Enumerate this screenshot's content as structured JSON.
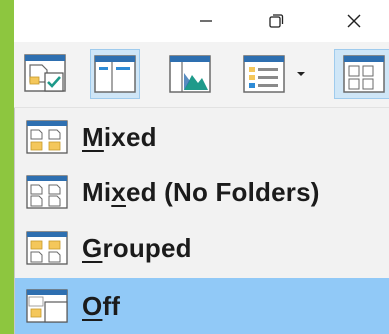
{
  "window": {
    "controls": [
      {
        "name": "minimize",
        "icon": "minimize-icon"
      },
      {
        "name": "restore",
        "icon": "restore-icon"
      },
      {
        "name": "close",
        "icon": "close-icon"
      }
    ]
  },
  "toolbar": {
    "buttons": [
      {
        "name": "check-boxes-button",
        "icon": "document-check-icon"
      },
      {
        "name": "navigation-pane-button",
        "icon": "panes-icon",
        "active": true
      },
      {
        "name": "preview-pane-button",
        "icon": "image-preview-icon"
      },
      {
        "name": "details-view-button",
        "icon": "list-details-icon",
        "has_dropdown": true
      },
      {
        "name": "layout-button",
        "icon": "grid-files-icon",
        "active": true
      }
    ]
  },
  "menu": {
    "items": [
      {
        "accel": "M",
        "rest": "ixed",
        "icon": "mixed-icon",
        "selected": false
      },
      {
        "accel": "",
        "pre": "Mi",
        "accel2": "x",
        "rest": "ed (No Folders)",
        "icon": "mixed-no-folders-icon",
        "selected": false
      },
      {
        "accel": "G",
        "rest": "rouped",
        "icon": "grouped-icon",
        "selected": false
      },
      {
        "accel": "O",
        "rest": "ff",
        "icon": "off-icon",
        "selected": true
      }
    ]
  },
  "colors": {
    "desktop": "#8dc63f",
    "selection": "#91c9f7",
    "accent": "#2e8bd6",
    "folder": "#f4c75b"
  }
}
